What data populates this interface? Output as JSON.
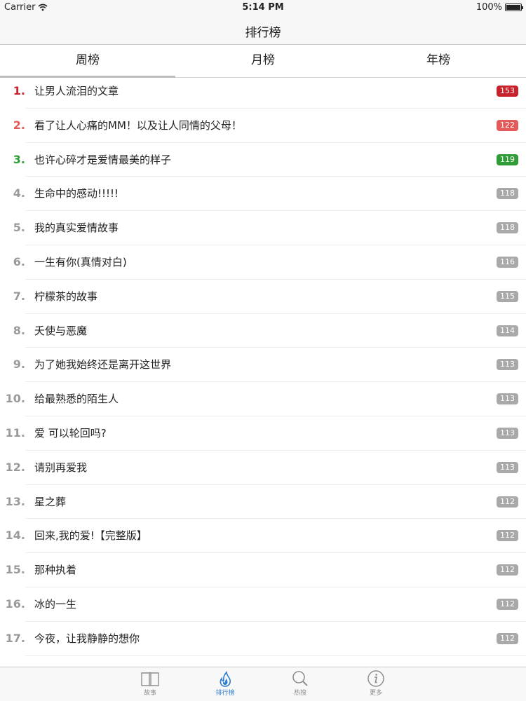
{
  "status": {
    "carrier": "Carrier",
    "time": "5:14 PM",
    "battery": "100%"
  },
  "nav": {
    "title": "排行榜"
  },
  "tabs": [
    {
      "label": "周榜",
      "active": true
    },
    {
      "label": "月榜",
      "active": false
    },
    {
      "label": "年榜",
      "active": false
    }
  ],
  "colors": {
    "rank1": "#c8232c",
    "rank2": "#e35b5b",
    "rank3": "#2e9d37",
    "rank_default": "#9a9a9a",
    "badge_default": "#a9a9a9",
    "badge1": "#c8232c",
    "badge2": "#e35b5b",
    "badge3": "#2e9d37",
    "tab_active": "#2d7dd2"
  },
  "items": [
    {
      "rank": "1.",
      "title": "让男人流泪的文章",
      "count": "153"
    },
    {
      "rank": "2.",
      "title": "看了让人心痛的MM！以及让人同情的父母！",
      "count": "122"
    },
    {
      "rank": "3.",
      "title": "也许心碎才是爱情最美的样子",
      "count": "119"
    },
    {
      "rank": "4.",
      "title": "生命中的感动!!!!!",
      "count": "118"
    },
    {
      "rank": "5.",
      "title": "我的真实爱情故事",
      "count": "118"
    },
    {
      "rank": "6.",
      "title": "一生有你(真情对白)",
      "count": "116"
    },
    {
      "rank": "7.",
      "title": "柠檬茶的故事",
      "count": "115"
    },
    {
      "rank": "8.",
      "title": "夭使与恶魔",
      "count": "114"
    },
    {
      "rank": "9.",
      "title": "为了她我始终还是离开这世界",
      "count": "113"
    },
    {
      "rank": "10.",
      "title": "给最熟悉的陌生人",
      "count": "113"
    },
    {
      "rank": "11.",
      "title": "爱  可以轮回吗?",
      "count": "113"
    },
    {
      "rank": "12.",
      "title": "请别再爱我",
      "count": "113"
    },
    {
      "rank": "13.",
      "title": "星之葬",
      "count": "112"
    },
    {
      "rank": "14.",
      "title": "回来,我的爱!【完整版】",
      "count": "112"
    },
    {
      "rank": "15.",
      "title": "那种执着",
      "count": "112"
    },
    {
      "rank": "16.",
      "title": "冰的一生",
      "count": "112"
    },
    {
      "rank": "17.",
      "title": "今夜，让我静静的想你",
      "count": "112"
    }
  ],
  "tabbar": [
    {
      "label": "故事",
      "icon": "book-icon",
      "active": false
    },
    {
      "label": "排行榜",
      "icon": "flame-icon",
      "active": true
    },
    {
      "label": "热搜",
      "icon": "search-icon",
      "active": false
    },
    {
      "label": "更多",
      "icon": "info-icon",
      "active": false
    }
  ]
}
